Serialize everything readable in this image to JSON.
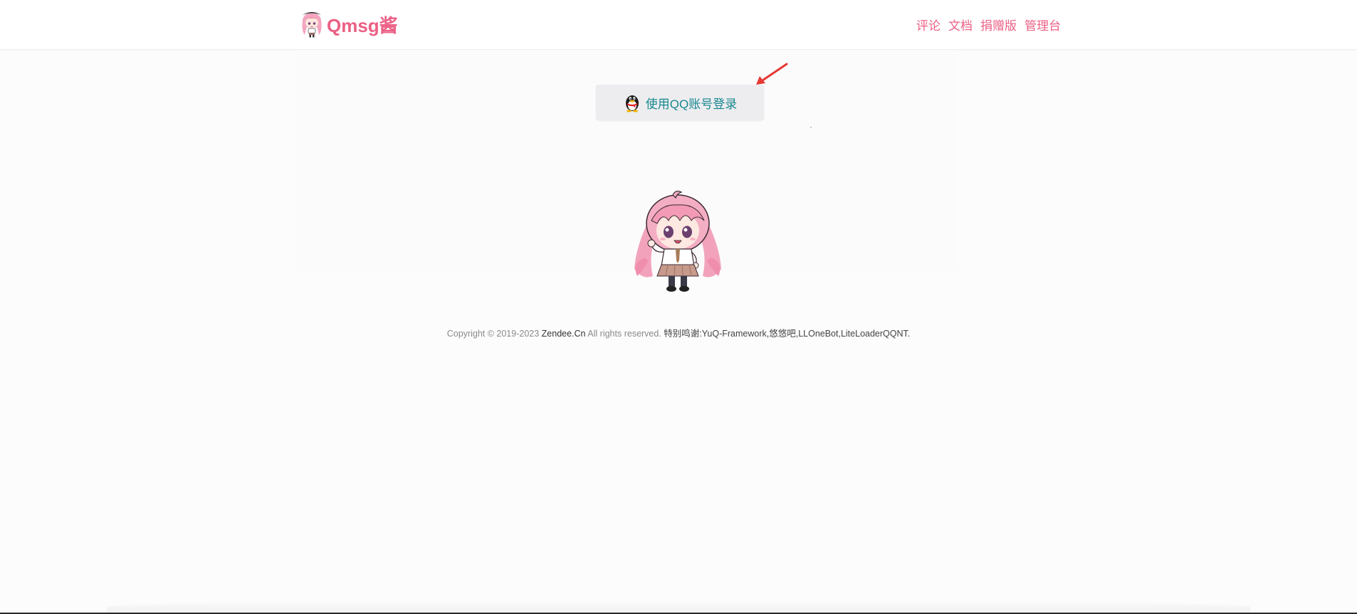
{
  "header": {
    "brand_name": "Qmsg酱",
    "nav": [
      {
        "label": "评论"
      },
      {
        "label": "文档"
      },
      {
        "label": "捐赠版"
      },
      {
        "label": "管理台"
      }
    ]
  },
  "login": {
    "button_label": "使用QQ账号登录",
    "icon": "qq-penguin-icon"
  },
  "annotation": {
    "arrow_color": "#e53935"
  },
  "footer": {
    "copyright_prefix": "Copyright © 2019-2023 ",
    "site_name": "Zendee.Cn",
    "rights": " All rights reserved. ",
    "thanks": "特别鸣谢:YuQ-Framework,悠悠吧,LLOneBot,LiteLoaderQQNT."
  },
  "colors": {
    "brand": "#ec6085",
    "login_text": "#17878e",
    "login_bg": "#ededf0"
  }
}
